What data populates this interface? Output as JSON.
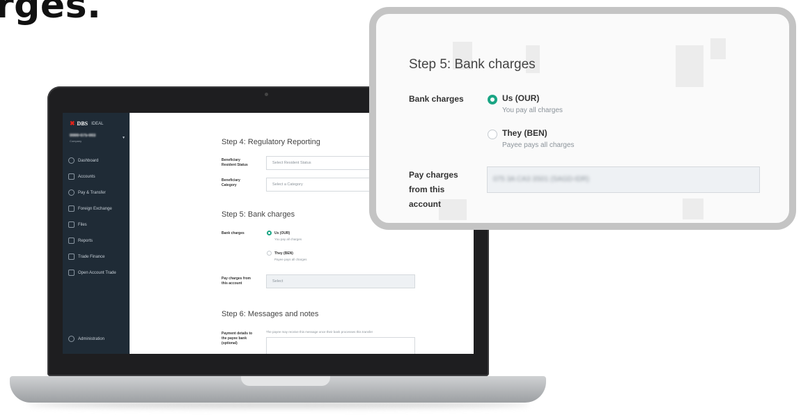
{
  "hero": {
    "title": "rges."
  },
  "sidebar": {
    "logo_mark": "✖",
    "logo_text": "DBS",
    "logo_sub": "IDEAL",
    "account_number": "0000-075-003",
    "account_name": "Company",
    "items": [
      {
        "label": "Dashboard",
        "icon": "home-icon"
      },
      {
        "label": "Accounts",
        "icon": "accounts-icon"
      },
      {
        "label": "Pay & Transfer",
        "icon": "pay-transfer-icon"
      },
      {
        "label": "Foreign Exchange",
        "icon": "foreign-exchange-icon"
      },
      {
        "label": "Files",
        "icon": "files-icon"
      },
      {
        "label": "Reports",
        "icon": "reports-icon"
      },
      {
        "label": "Trade Finance",
        "icon": "trade-finance-icon"
      },
      {
        "label": "Open Account Trade",
        "icon": "open-account-trade-icon"
      }
    ],
    "admin": {
      "label": "Administration",
      "icon": "admin-icon"
    }
  },
  "form": {
    "step4": {
      "title": "Step 4: Regulatory Reporting",
      "resident_label": "Beneficiary Resident Status",
      "resident_placeholder": "Select Resident Status",
      "category_label": "Beneficiary Category",
      "category_placeholder": "Select a Category"
    },
    "step5": {
      "title": "Step 5: Bank charges",
      "charges_label": "Bank charges",
      "opt_our": "Us (OUR)",
      "opt_our_sub": "You pay all charges",
      "opt_ben": "They (BEN)",
      "opt_ben_sub": "Payee pays all charges",
      "pay_from_label": "Pay charges from this account",
      "pay_from_placeholder": "Select"
    },
    "step6": {
      "title": "Step 6: Messages and notes",
      "details_label": "Payment details to the payee bank (optional)",
      "details_hint": "The payee may receive this message once their bank processes this transfer"
    }
  },
  "zoom": {
    "title": "Step 5: Bank charges",
    "charges_label": "Bank charges",
    "opt_our": "Us (OUR)",
    "opt_our_sub": "You pay all charges",
    "opt_ben": "They (BEN)",
    "opt_ben_sub": "Payee pays all charges",
    "pay_from_label": "Pay charges from this account",
    "pay_from_value": "075 3A CA3 3S01 (SAGD-IDR)",
    "selected_option": "Us (OUR)",
    "accent": "#1aa584"
  }
}
